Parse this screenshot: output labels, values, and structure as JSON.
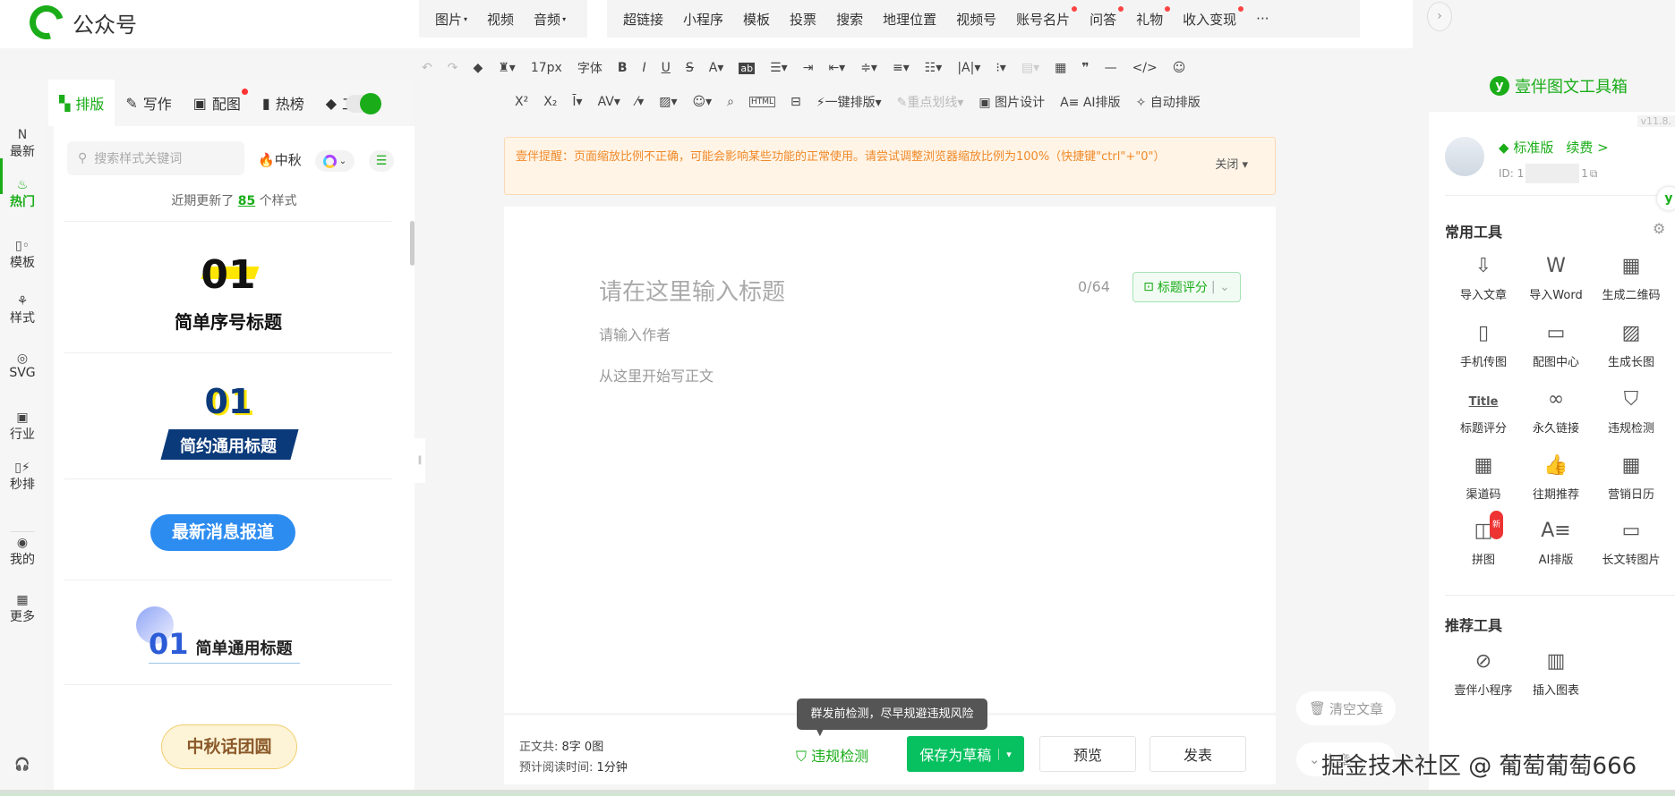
{
  "header": {
    "app_name": "公众号",
    "insert_menu_1": [
      "图片",
      "视频",
      "音频"
    ],
    "insert_menu_2": [
      {
        "label": "超链接",
        "dot": false
      },
      {
        "label": "小程序",
        "dot": false
      },
      {
        "label": "模板",
        "dot": false
      },
      {
        "label": "投票",
        "dot": false
      },
      {
        "label": "搜索",
        "dot": false
      },
      {
        "label": "地理位置",
        "dot": false
      },
      {
        "label": "视频号",
        "dot": false
      },
      {
        "label": "账号名片",
        "dot": true
      },
      {
        "label": "问答",
        "dot": true
      },
      {
        "label": "礼物",
        "dot": true
      },
      {
        "label": "收入变现",
        "dot": true
      }
    ],
    "more": "···"
  },
  "rail": {
    "items": [
      {
        "label": "最新",
        "icon": "N"
      },
      {
        "label": "热门",
        "icon": "♨"
      },
      {
        "label": "模板",
        "icon": "▯◦"
      },
      {
        "label": "样式",
        "icon": "⚘"
      },
      {
        "label": "SVG",
        "icon": "◎"
      },
      {
        "label": "行业",
        "icon": "▣"
      },
      {
        "label": "秒排",
        "icon": "▯⚡"
      },
      {
        "label": "我的",
        "icon": "◉"
      },
      {
        "label": "更多",
        "icon": "▦"
      }
    ],
    "support_icon": "🎧"
  },
  "tabs": [
    {
      "label": "排版",
      "icon": "▚"
    },
    {
      "label": "写作",
      "icon": "✎"
    },
    {
      "label": "配图",
      "icon": "▣"
    },
    {
      "label": "热榜",
      "icon": "▮"
    },
    {
      "label": "工具",
      "icon": "◆"
    }
  ],
  "style_panel": {
    "search_placeholder": "搜索样式关键词",
    "festival": "中秋",
    "update_prefix": "近期更新了",
    "update_count": "85",
    "update_suffix": "个样式",
    "cards": [
      {
        "num": "01",
        "title": "简单序号标题"
      },
      {
        "num": "01",
        "title": "简约通用标题"
      },
      {
        "title": "最新消息报道"
      },
      {
        "num": "01",
        "title": "简单通用标题"
      },
      {
        "title": "中秋话团圆"
      }
    ]
  },
  "toolbar": {
    "font_size": "17px",
    "font_family": "字体",
    "row2": [
      "一键排版",
      "重点划线",
      "图片设计",
      "AI排版",
      "自动排版"
    ]
  },
  "notice": {
    "text": "壹伴提醒：页面缩放比例不正确，可能会影响某些功能的正常使用。请尝试调整浏览器缩放比例为100%（快捷键\"ctrl\"+\"0\"）",
    "close": "关闭"
  },
  "editor": {
    "title_placeholder": "请在这里输入标题",
    "title_count": "0/64",
    "title_score": "标题评分",
    "author_placeholder": "请输入作者",
    "body_placeholder": "从这里开始写正文"
  },
  "footer": {
    "word_count_label": "正文共:",
    "word_count": "8字 0图",
    "read_time_label": "预计阅读时间:",
    "read_time": "1分钟",
    "check": "违规检测",
    "tooltip": "群发前检测，尽早规避违规风险",
    "save": "保存为草稿",
    "preview": "预览",
    "publish": "发表",
    "clear": "清空文章",
    "article": "文章"
  },
  "toolbox": {
    "title": "壹伴图文工具箱",
    "version": "v11.8.",
    "plan": "标准版",
    "renew": "续费 >",
    "id_prefix": "ID: 1",
    "id_suffix": "1",
    "common_title": "常用工具",
    "common": [
      {
        "label": "导入文章",
        "icon": "⇩"
      },
      {
        "label": "导入Word",
        "icon": "W"
      },
      {
        "label": "生成二维码",
        "icon": "▦"
      },
      {
        "label": "手机传图",
        "icon": "▯"
      },
      {
        "label": "配图中心",
        "icon": "▭"
      },
      {
        "label": "生成长图",
        "icon": "▨"
      },
      {
        "label": "标题评分",
        "icon": "Title"
      },
      {
        "label": "永久链接",
        "icon": "∞"
      },
      {
        "label": "违规检测",
        "icon": "⛉"
      },
      {
        "label": "渠道码",
        "icon": "▦"
      },
      {
        "label": "往期推荐",
        "icon": "👍"
      },
      {
        "label": "营销日历",
        "icon": "▦"
      },
      {
        "label": "拼图",
        "icon": "◫",
        "badge": "新"
      },
      {
        "label": "AI排版",
        "icon": "A≡"
      },
      {
        "label": "长文转图片",
        "icon": "▭"
      }
    ],
    "rec_title": "推荐工具",
    "recommended": [
      {
        "label": "壹伴小程序",
        "icon": "⊘"
      },
      {
        "label": "插入图表",
        "icon": "▥"
      }
    ]
  },
  "watermark": "掘金技术社区 @ 葡萄葡萄666"
}
